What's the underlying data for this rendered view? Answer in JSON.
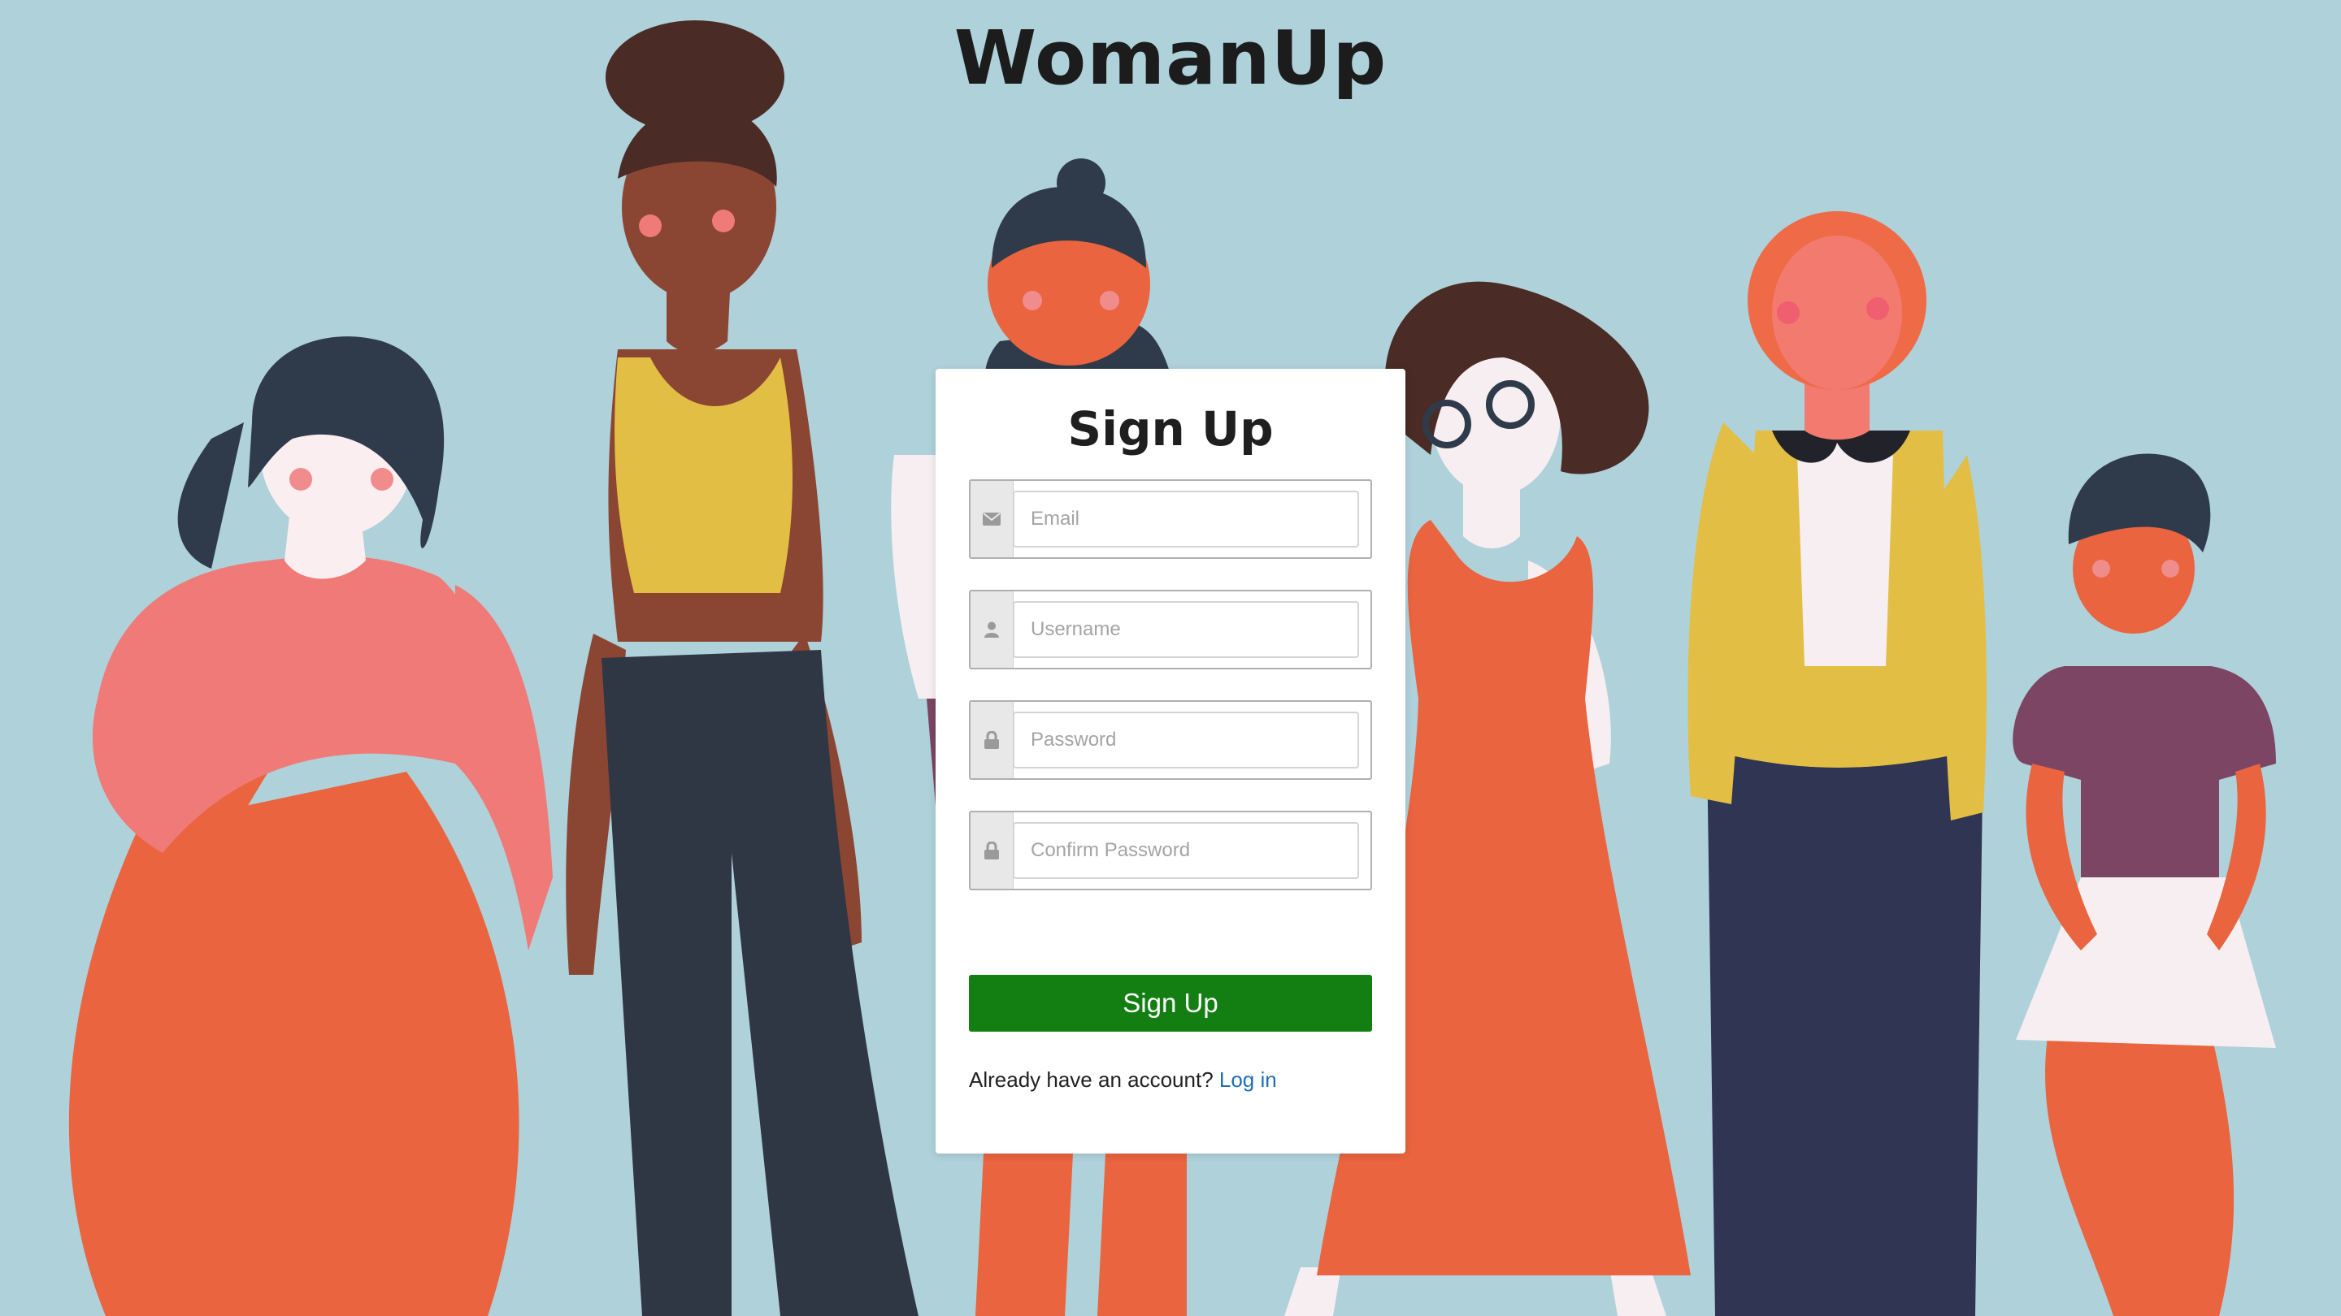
{
  "app": {
    "brand": "WomanUp"
  },
  "signup": {
    "title": "Sign Up",
    "fields": [
      {
        "icon": "envelope-icon",
        "placeholder": "Email",
        "value": ""
      },
      {
        "icon": "user-icon",
        "placeholder": "Username",
        "value": ""
      },
      {
        "icon": "lock-icon",
        "placeholder": "Password",
        "value": ""
      },
      {
        "icon": "lock-icon",
        "placeholder": "Confirm Password",
        "value": ""
      }
    ],
    "submit_label": "Sign Up",
    "login_prompt": "Already have an account?",
    "login_link": "Log in"
  },
  "colors": {
    "background": "#afd1da",
    "primary_button": "#137f12",
    "link": "#1f6fb6",
    "card": "#ffffff"
  },
  "illustration": {
    "subject": "six-women-illustration"
  }
}
